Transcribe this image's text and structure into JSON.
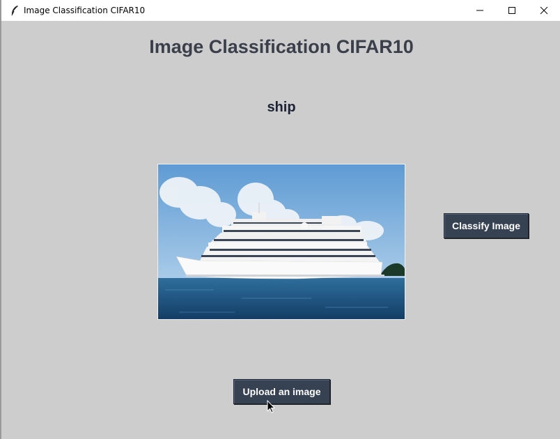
{
  "window": {
    "title": "Image Classification CIFAR10",
    "app_icon": "feather-icon",
    "controls": [
      "minimize-icon",
      "maximize-icon",
      "close-icon"
    ]
  },
  "main": {
    "heading": "Image Classification CIFAR10",
    "prediction": "ship",
    "image": "cruise ship on blue sea with cloudy sky",
    "classify_label": "Classify Image",
    "upload_label": "Upload an image"
  },
  "colors": {
    "background": "#cdcdcd",
    "button": "#364152",
    "heading": "#3a3f4a"
  }
}
